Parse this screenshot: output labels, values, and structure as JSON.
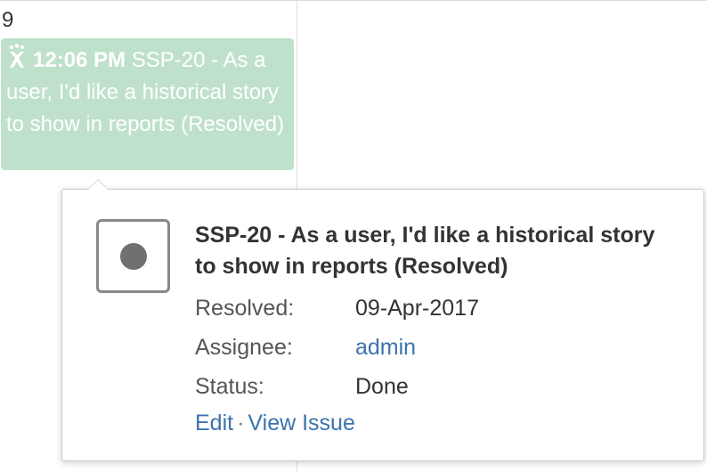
{
  "calendar": {
    "day_number": "9",
    "event": {
      "time": "12:06 PM",
      "text": "SSP-20 - As a user, I'd like a historical story to show in reports (Resolved)",
      "icon": "issue-type-icon",
      "color": "#bfe1cb"
    }
  },
  "popup": {
    "title": "SSP-20 - As a user, I'd like a historical story to show in reports (Resolved)",
    "status_icon": "status-dot-icon",
    "fields": {
      "resolved_label": "Resolved:",
      "resolved_value": "09-Apr-2017",
      "assignee_label": "Assignee:",
      "assignee_value": "admin",
      "status_label": "Status:",
      "status_value": "Done"
    },
    "actions": {
      "edit_label": "Edit",
      "separator": "·",
      "view_label": "View Issue"
    },
    "link_color": "#3b73af"
  }
}
